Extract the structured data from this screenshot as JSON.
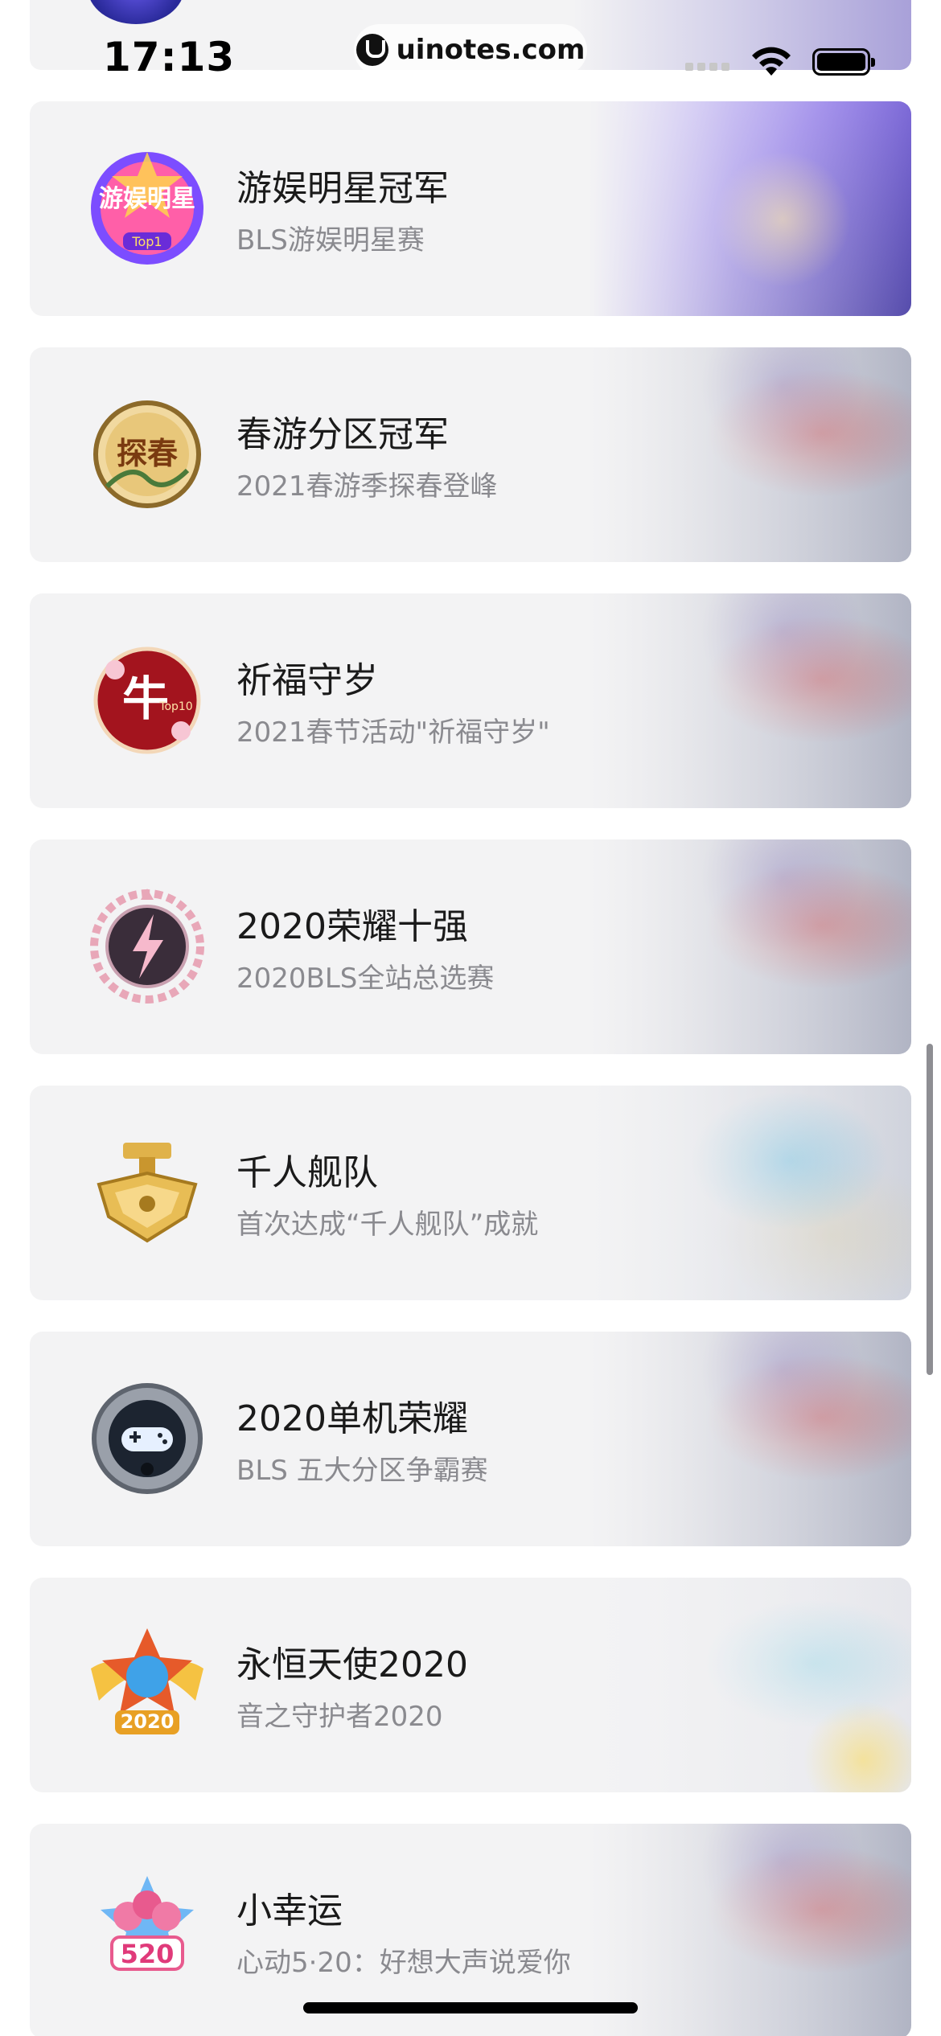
{
  "status_bar": {
    "time": "17:13",
    "url": "uinotes.com",
    "wifi_icon": "wifi-icon",
    "battery_icon": "battery-icon",
    "signal_icon": "cellular-signal-icon"
  },
  "medals": [
    {
      "title": "游娱明星冠军",
      "subtitle": "BLS游娱明星赛",
      "icon": "star-champion-medal-icon",
      "badge_text": "游娱明星",
      "accent": "#8b5cf6"
    },
    {
      "title": "春游分区冠军",
      "subtitle": "2021春游季探春登峰",
      "icon": "spring-champion-medal-icon",
      "badge_text": "探春",
      "accent": "#b08a3c"
    },
    {
      "title": "祈福守岁",
      "subtitle": "2021春节活动\"祈福守岁\"",
      "icon": "new-year-ox-medal-icon",
      "badge_text": "牛",
      "accent": "#b3202a"
    },
    {
      "title": "2020荣耀十强",
      "subtitle": "2020BLS全站总选赛",
      "icon": "lightning-wreath-medal-icon",
      "badge_text": "",
      "accent": "#3a2d3a"
    },
    {
      "title": "千人舰队",
      "subtitle": "首次达成“千人舰队”成就",
      "icon": "fleet-anchor-medal-icon",
      "badge_text": "",
      "accent": "#d4a53a"
    },
    {
      "title": "2020单机荣耀",
      "subtitle": "BLS 五大分区争霸赛",
      "icon": "gamepad-wreath-medal-icon",
      "badge_text": "",
      "accent": "#1f2a3a"
    },
    {
      "title": "永恒天使2020",
      "subtitle": "音之守护者2020",
      "icon": "angel-wings-medal-icon",
      "badge_text": "2020",
      "accent": "#e8a024"
    },
    {
      "title": "小幸运",
      "subtitle": "心动5·20：好想大声说爱你",
      "icon": "roses-520-medal-icon",
      "badge_text": "520",
      "accent": "#e0528a"
    }
  ]
}
